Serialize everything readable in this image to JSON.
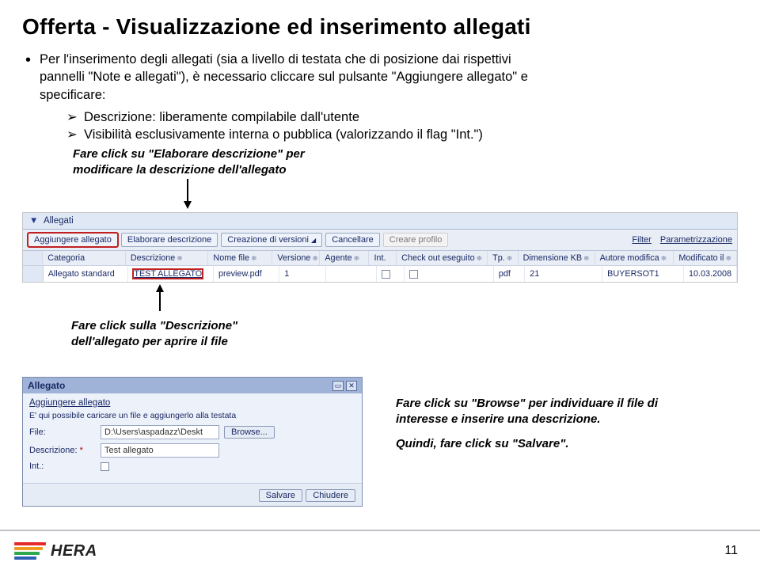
{
  "title": "Offerta - Visualizzazione ed inserimento allegati",
  "intro_line1": "Per l'inserimento degli allegati (sia a livello di testata che di posizione dai rispettivi",
  "intro_line2": "pannelli \"Note e allegati\"), è necessario cliccare sul pulsante \"Aggiungere allegato\" e",
  "intro_line3": "specificare:",
  "arrow_items": [
    "Descrizione: liberamente compilabile dall'utente",
    "Visibilità esclusivamente interna o pubblica (valorizzando il flag \"Int.\")"
  ],
  "caption1_l1": "Fare click su \"Elaborare descrizione\" per",
  "caption1_l2": "modificare la descrizione dell'allegato",
  "caption2_l1": "Fare click sulla \"Descrizione\"",
  "caption2_l2": "dell'allegato per aprire il file",
  "caption3_l1": "Fare click su \"Browse\" per individuare il file di",
  "caption3_l2": "interesse e inserire una descrizione.",
  "caption3_l3": "Quindi, fare click su \"Salvare\".",
  "page_number": "11",
  "logo_text": "HERA",
  "toolbar": {
    "section": "Allegati",
    "btn_add": "Aggiungere allegato",
    "btn_edit": "Elaborare descrizione",
    "btn_version": "Creazione di versioni",
    "btn_delete": "Cancellare",
    "btn_profile": "Creare profilo",
    "link_filter": "Filter",
    "link_param": "Parametrizzazione"
  },
  "columns": {
    "c1": "Categoria",
    "c2": "Descrizione",
    "c3": "Nome file",
    "c4": "Versione",
    "c5": "Agente",
    "c6": "Int.",
    "c7": "Check out eseguito",
    "c8": "Tp.",
    "c9": "Dimensione KB",
    "c10": "Autore modifica",
    "c11": "Modificato il"
  },
  "row1": {
    "c1": "Allegato standard",
    "c2": "TEST ALLEGATO",
    "c3": "preview.pdf",
    "c4": "1",
    "c5": "",
    "c6": "",
    "c7": "",
    "c8": "pdf",
    "c9": "21",
    "c10": "BUYERSOT1",
    "c11": "10.03.2008"
  },
  "dialog": {
    "title": "Allegato",
    "link": "Aggiungere allegato",
    "note": "E' qui possibile caricare un file e aggiungerlo alla testata",
    "lbl_file": "File:",
    "val_file": "D:\\Users\\aspadazz\\Deskt",
    "btn_browse": "Browse...",
    "lbl_desc": "Descrizione:",
    "val_desc": "Test allegato",
    "lbl_int": "Int.:",
    "btn_save": "Salvare",
    "btn_close": "Chiudere"
  }
}
